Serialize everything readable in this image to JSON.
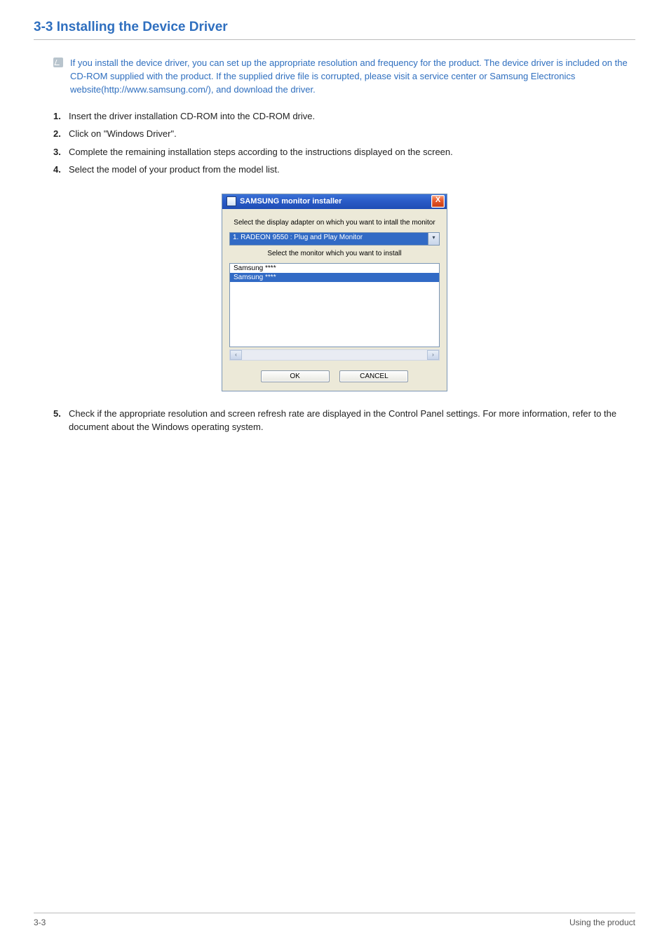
{
  "heading": "3-3    Installing the Device Driver",
  "note": "If you install the device driver, you can set up the appropriate resolution and frequency for the product. The device driver is included on the CD-ROM supplied with the product. If the supplied drive file is corrupted, please visit a service center or Samsung Electronics website(http://www.samsung.com/), and download the driver.",
  "steps": [
    "Insert the driver installation CD-ROM into the CD-ROM drive.",
    "Click on \"Windows Driver\".",
    "Complete the remaining installation steps according to the instructions displayed on the screen.",
    "Select the model of your product from the model list."
  ],
  "dialog": {
    "title": "SAMSUNG monitor installer",
    "close": "X",
    "label1": "Select the display adapter on which you want to intall the monitor",
    "combo_value": "1. RADEON 9550 : Plug and Play Monitor",
    "combo_arrow": "▾",
    "label2": "Select the monitor which you want to install",
    "list": {
      "item0": "Samsung ****",
      "item1": "Samsung ****"
    },
    "scroll_left": "‹",
    "scroll_right": "›",
    "ok": "OK",
    "cancel": "CANCEL"
  },
  "step5": "Check if the appropriate resolution and screen refresh rate are displayed in the Control Panel settings. For more information, refer to the document about the Windows operating system.",
  "footer": {
    "left": "3-3",
    "right": "Using the product"
  }
}
